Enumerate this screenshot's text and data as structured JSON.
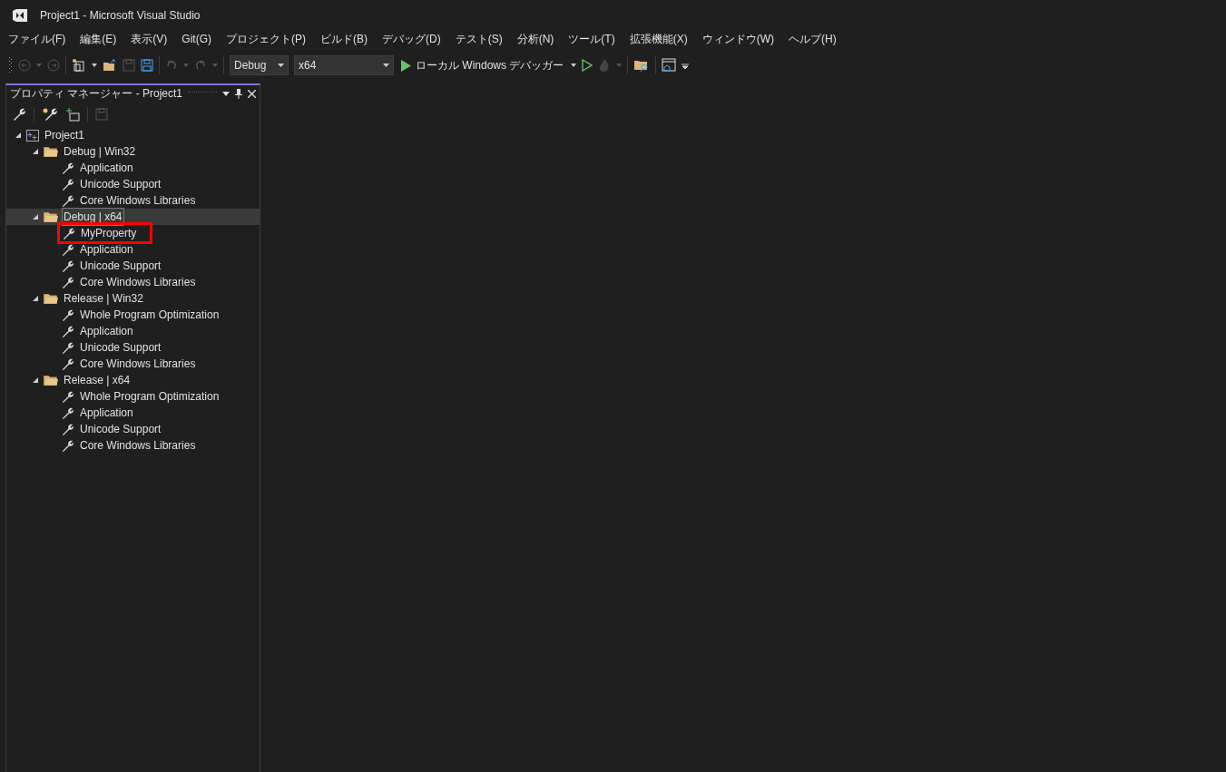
{
  "window": {
    "title": "Project1 - Microsoft Visual Studio"
  },
  "menu": [
    "ファイル(F)",
    "編集(E)",
    "表示(V)",
    "Git(G)",
    "プロジェクト(P)",
    "ビルド(B)",
    "デバッグ(D)",
    "テスト(S)",
    "分析(N)",
    "ツール(T)",
    "拡張機能(X)",
    "ウィンドウ(W)",
    "ヘルプ(H)"
  ],
  "toolbar": {
    "configuration": "Debug",
    "platform": "x64",
    "debugger": "ローカル Windows デバッガー"
  },
  "panel": {
    "title": "プロパティ マネージャー - Project1",
    "tree": [
      {
        "label": "Project1",
        "kind": "project",
        "expanded": true,
        "selected": false,
        "children": [
          {
            "label": "Debug | Win32",
            "kind": "folder",
            "expanded": true,
            "selected": false,
            "children": [
              {
                "label": "Application",
                "kind": "sheet",
                "selected": false,
                "highlighted": false
              },
              {
                "label": "Unicode Support",
                "kind": "sheet",
                "selected": false,
                "highlighted": false
              },
              {
                "label": "Core Windows Libraries",
                "kind": "sheet",
                "selected": false,
                "highlighted": false
              }
            ]
          },
          {
            "label": "Debug | x64",
            "kind": "folder",
            "expanded": true,
            "selected": true,
            "children": [
              {
                "label": "MyProperty",
                "kind": "sheet",
                "selected": false,
                "highlighted": true
              },
              {
                "label": "Application",
                "kind": "sheet",
                "selected": false,
                "highlighted": false
              },
              {
                "label": "Unicode Support",
                "kind": "sheet",
                "selected": false,
                "highlighted": false
              },
              {
                "label": "Core Windows Libraries",
                "kind": "sheet",
                "selected": false,
                "highlighted": false
              }
            ]
          },
          {
            "label": "Release | Win32",
            "kind": "folder",
            "expanded": true,
            "selected": false,
            "children": [
              {
                "label": "Whole Program Optimization",
                "kind": "sheet",
                "selected": false,
                "highlighted": false
              },
              {
                "label": "Application",
                "kind": "sheet",
                "selected": false,
                "highlighted": false
              },
              {
                "label": "Unicode Support",
                "kind": "sheet",
                "selected": false,
                "highlighted": false
              },
              {
                "label": "Core Windows Libraries",
                "kind": "sheet",
                "selected": false,
                "highlighted": false
              }
            ]
          },
          {
            "label": "Release | x64",
            "kind": "folder",
            "expanded": true,
            "selected": false,
            "children": [
              {
                "label": "Whole Program Optimization",
                "kind": "sheet",
                "selected": false,
                "highlighted": false
              },
              {
                "label": "Application",
                "kind": "sheet",
                "selected": false,
                "highlighted": false
              },
              {
                "label": "Unicode Support",
                "kind": "sheet",
                "selected": false,
                "highlighted": false
              },
              {
                "label": "Core Windows Libraries",
                "kind": "sheet",
                "selected": false,
                "highlighted": false
              }
            ]
          }
        ]
      }
    ]
  }
}
